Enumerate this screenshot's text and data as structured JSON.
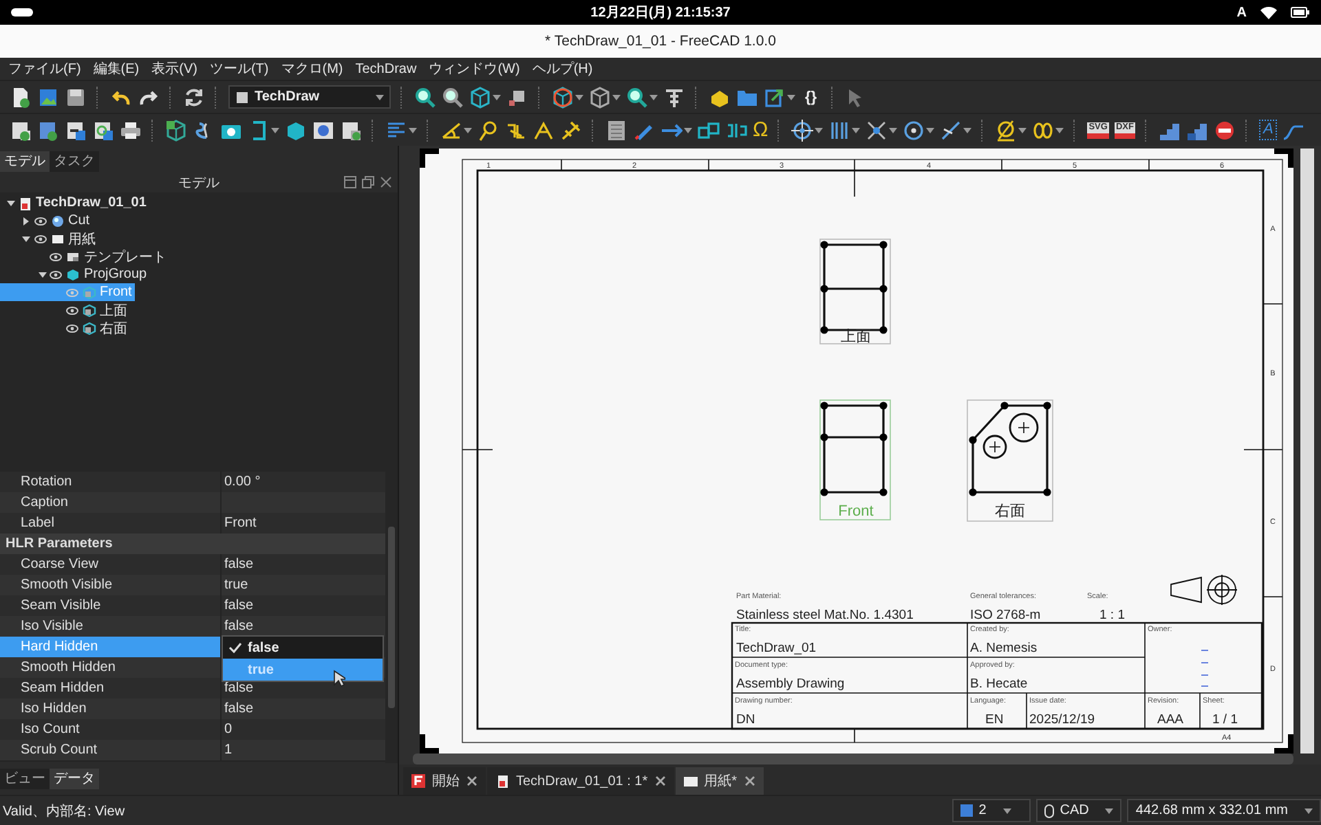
{
  "system_bar": {
    "clock": "12月22日(月) 21:15:37",
    "input_method": "A"
  },
  "window": {
    "title": "* TechDraw_01_01 - FreeCAD 1.0.0"
  },
  "menu": [
    "ファイル(F)",
    "編集(E)",
    "表示(V)",
    "ツール(T)",
    "マクロ(M)",
    "TechDraw",
    "ウィンドウ(W)",
    "ヘルプ(H)"
  ],
  "toolbar_1": {
    "workbench": "TechDraw",
    "macro_button": "{}"
  },
  "toolbar_2": {
    "symbol_button": "Ω",
    "export_buttons": [
      "SVG",
      "DXF"
    ],
    "text_button": "A"
  },
  "panel_tabs": [
    {
      "label": "モデル",
      "selected": true
    },
    {
      "label": "タスク",
      "selected": false
    }
  ],
  "panel_title": "モデル",
  "tree": {
    "label": "TechDraw_01_01",
    "kind": "document",
    "expanded": true,
    "selected": false,
    "children": [
      {
        "label": "Cut",
        "kind": "solid",
        "expanded": false,
        "selected": false
      },
      {
        "label": "用紙",
        "kind": "page",
        "expanded": true,
        "selected": false,
        "children": [
          {
            "label": "テンプレート",
            "kind": "template",
            "selected": false
          },
          {
            "label": "ProjGroup",
            "kind": "group",
            "expanded": true,
            "selected": false,
            "children": [
              {
                "label": "Front",
                "kind": "view",
                "selected": true
              },
              {
                "label": "上面",
                "kind": "view",
                "selected": false
              },
              {
                "label": "右面",
                "kind": "view",
                "selected": false
              }
            ]
          }
        ]
      }
    ]
  },
  "properties": [
    {
      "kind": "property",
      "name": "Rotation",
      "value": "0.00 °",
      "selected": false
    },
    {
      "kind": "property",
      "name": "Caption",
      "selected": false
    },
    {
      "kind": "property",
      "name": "Label",
      "value": "Front",
      "selected": false
    },
    {
      "kind": "group",
      "name": "HLR Parameters"
    },
    {
      "kind": "property",
      "name": "Coarse View",
      "value": "false",
      "selected": false
    },
    {
      "kind": "property",
      "name": "Smooth Visible",
      "value": "true",
      "selected": false
    },
    {
      "kind": "property",
      "name": "Seam Visible",
      "value": "false",
      "selected": false
    },
    {
      "kind": "property",
      "name": "Iso Visible",
      "value": "false",
      "selected": false
    },
    {
      "kind": "property",
      "name": "Hard Hidden",
      "selected": true,
      "dropdown": [
        {
          "label": "false",
          "checked": true,
          "highlighted": false
        },
        {
          "label": "true",
          "checked": false,
          "highlighted": true
        }
      ]
    },
    {
      "kind": "property",
      "name": "Smooth Hidden",
      "selected": false
    },
    {
      "kind": "property",
      "name": "Seam Hidden",
      "value": "false",
      "selected": false
    },
    {
      "kind": "property",
      "name": "Iso Hidden",
      "value": "false",
      "selected": false
    },
    {
      "kind": "property",
      "name": "Iso Count",
      "value": "0",
      "selected": false
    },
    {
      "kind": "property",
      "name": "Scrub Count",
      "value": "1",
      "selected": false
    }
  ],
  "bottom_tabs": [
    {
      "label": "ビュー",
      "selected": false
    },
    {
      "label": "データ",
      "selected": true
    }
  ],
  "sheet": {
    "column_numbers": [
      "1",
      "2",
      "3",
      "4",
      "5",
      "6"
    ],
    "row_letters": [
      "A",
      "B",
      "C",
      "D"
    ],
    "size": "A4",
    "views": [
      {
        "kind": "top",
        "label": "上面",
        "selected": false
      },
      {
        "kind": "front",
        "label": "Front",
        "selected": true
      },
      {
        "kind": "right",
        "label": "右面",
        "selected": false
      }
    ],
    "title_block": [
      {
        "label": "Part Material:",
        "value": "Stainless steel Mat.No. 1.4301"
      },
      {
        "label": "General tolerances:",
        "value": "ISO 2768-m"
      },
      {
        "label": "Scale:",
        "value": "1 : 1"
      },
      {
        "label": "Title:",
        "value": "TechDraw_01"
      },
      {
        "label": "Created by:",
        "value": "A. Nemesis"
      },
      {
        "label": "Owner:"
      },
      {
        "label": "Document type:",
        "value": "Assembly Drawing"
      },
      {
        "label": "Approved by:",
        "value": "B. Hecate"
      },
      {
        "label": "Drawing number:",
        "value": "DN"
      },
      {
        "label": "Language:",
        "value": "EN"
      },
      {
        "label": "Issue date:",
        "value": "2025/12/19"
      },
      {
        "label": "Revision:",
        "value": "AAA"
      },
      {
        "label": "Sheet:",
        "value": "1 / 1"
      }
    ]
  },
  "document_tabs": [
    {
      "kind": "start",
      "label": "開始",
      "selected": false
    },
    {
      "kind": "document",
      "label": "TechDraw_01_01 : 1*",
      "selected": false
    },
    {
      "kind": "page",
      "label": "用紙*",
      "selected": true
    }
  ],
  "status_bar": {
    "message": "Valid、内部名: View",
    "view_number": "2",
    "navigation": "CAD",
    "page_size": "442.68 mm x 332.01 mm"
  }
}
